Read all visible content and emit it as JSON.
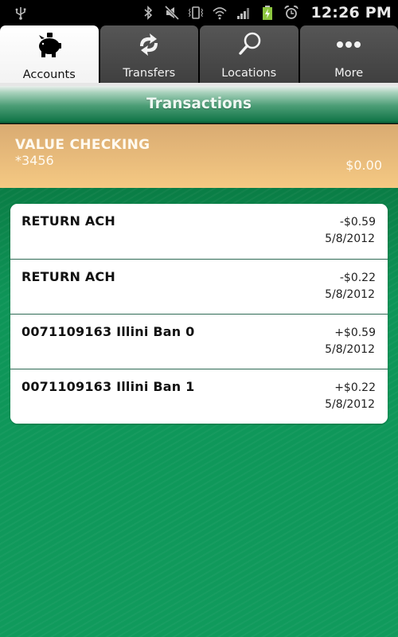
{
  "status_bar": {
    "left_icons": [
      "usb-icon"
    ],
    "right_icons": [
      "bluetooth-icon",
      "mute-icon",
      "vibrate-icon",
      "wifi-icon",
      "signal-icon",
      "battery-charging-icon",
      "alarm-icon"
    ],
    "time": "12:26 PM"
  },
  "tabs": [
    {
      "label": "Accounts",
      "icon": "piggy-bank-icon",
      "active": true
    },
    {
      "label": "Transfers",
      "icon": "transfer-arrows-icon",
      "active": false
    },
    {
      "label": "Locations",
      "icon": "search-icon",
      "active": false
    },
    {
      "label": "More",
      "icon": "more-dots-icon",
      "active": false
    }
  ],
  "header": {
    "title": "Transactions"
  },
  "account": {
    "name": "VALUE CHECKING",
    "number": "*3456",
    "balance": "$0.00"
  },
  "transactions": [
    {
      "description": "RETURN ACH",
      "amount": "-$0.59",
      "date": "5/8/2012"
    },
    {
      "description": "RETURN ACH",
      "amount": "-$0.22",
      "date": "5/8/2012"
    },
    {
      "description": "0071109163 Illini Ban 0",
      "amount": "+$0.59",
      "date": "5/8/2012"
    },
    {
      "description": "0071109163 Illini Ban 1",
      "amount": "+$0.22",
      "date": "5/8/2012"
    }
  ],
  "colors": {
    "brand_green": "#0e9558",
    "account_bar": "#f0c27f",
    "status_bar_bg": "#000000"
  }
}
